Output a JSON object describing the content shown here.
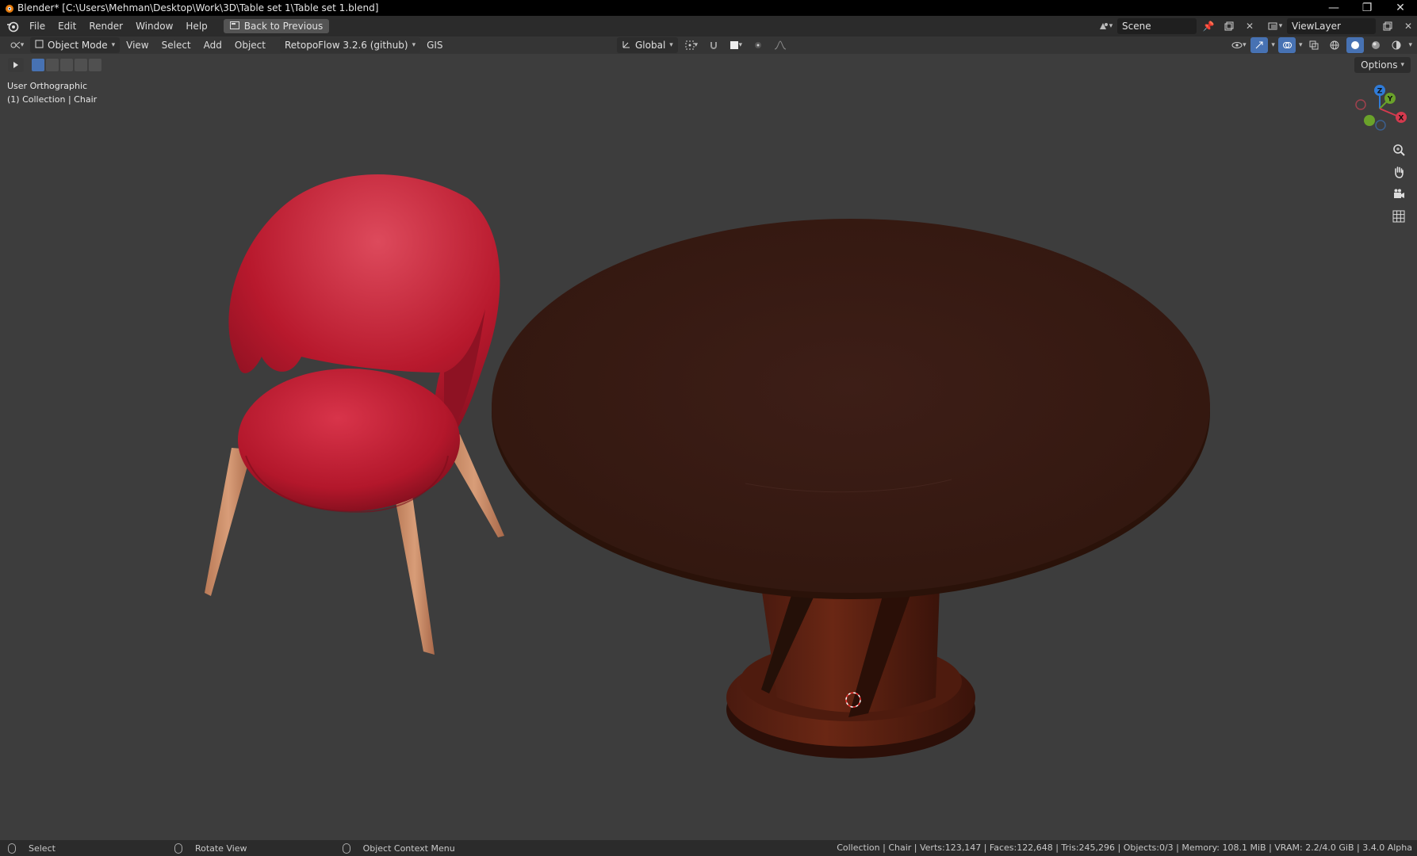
{
  "window": {
    "title": "Blender* [C:\\Users\\Mehman\\Desktop\\Work\\3D\\Table set 1\\Table set 1.blend]",
    "controls": [
      "minimize-icon",
      "restore-icon",
      "close-icon"
    ]
  },
  "menubar": {
    "items": [
      "File",
      "Edit",
      "Render",
      "Window",
      "Help"
    ],
    "back_label": "Back to Previous",
    "scene_value": "Scene",
    "viewlayer_value": "ViewLayer"
  },
  "header3d": {
    "mode_label": "Object Mode",
    "menus": [
      "View",
      "Select",
      "Add",
      "Object"
    ],
    "addon_label": "RetopoFlow 3.2.6 (github)",
    "gis_label": "GIS",
    "orientation_label": "Global",
    "options_label": "Options"
  },
  "viewport": {
    "view_name": "User Orthographic",
    "collection_info": "(1) Collection | Chair",
    "gizmo_axes": {
      "z": "Z",
      "y": "Y",
      "x": "X"
    }
  },
  "statusbar": {
    "hint_select": "Select",
    "hint_rotate": "Rotate View",
    "hint_context": "Object Context Menu",
    "stats": "Collection | Chair | Verts:123,147 | Faces:122,648 | Tris:245,296 | Objects:0/3 | Memory: 108.1 MiB | VRAM: 2.2/4.0 GiB | 3.4.0 Alpha"
  },
  "colors": {
    "viewport_bg": "#3d3d3d",
    "chair_red": "#b81a2e",
    "chair_leg": "#c78a66",
    "table_top": "#3a1c15",
    "accent_blue": "#4772b3"
  }
}
